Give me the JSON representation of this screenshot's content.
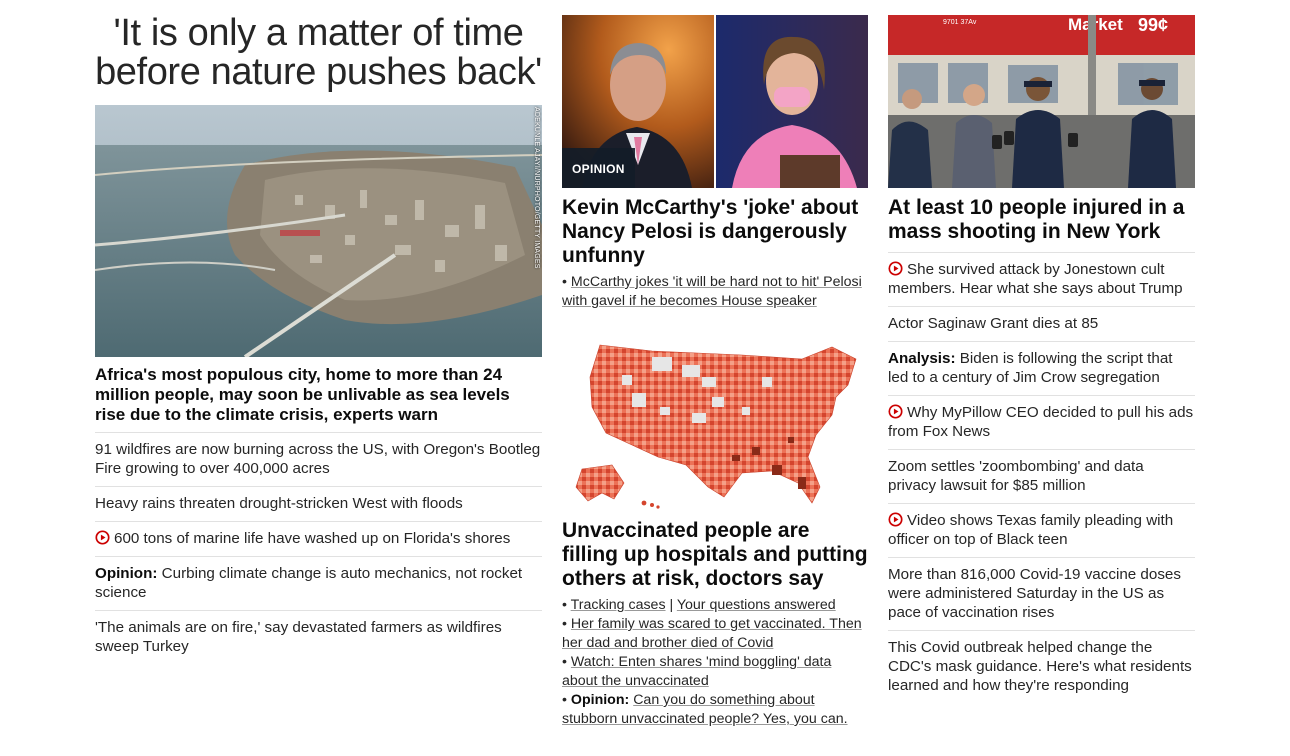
{
  "col1": {
    "headline": "'It is only a matter of time before nature pushes back'",
    "photo_credit": "ADEKUNLE AJAYI/NURPHOTO/GETTY IMAGES",
    "lead": "Africa's most populous city, home to more than 24 million people, may soon be unlivable as sea levels rise due to the climate crisis, experts warn",
    "items": [
      {
        "text": "91 wildfires are now burning across the US, with Oregon's Bootleg Fire growing to over 400,000 acres"
      },
      {
        "text": "Heavy rains threaten drought-stricken West with floods"
      },
      {
        "text": "600 tons of marine life have washed up on Florida's shores",
        "icon": "play-icon"
      },
      {
        "prefix": "Opinion:",
        "text": "Curbing climate change is auto mechanics, not rocket science"
      },
      {
        "text": "'The animals are on fire,' say devastated farmers as wildfires sweep Turkey"
      }
    ]
  },
  "col2": {
    "badge": "OPINION",
    "lead": "Kevin McCarthy's 'joke' about Nancy Pelosi is dangerously unfunny",
    "related": "McCarthy jokes 'it will be hard not to hit' Pelosi with gavel if he becomes House speaker",
    "lead2": "Unvaccinated people are filling up hospitals and putting others at risk, doctors say",
    "bullets": {
      "tracking": "Tracking cases",
      "separator": " | ",
      "questions": "Your questions answered",
      "family": "Her family was scared to get vaccinated. Then her dad and brother died of Covid",
      "watch": "Watch: Enten shares 'mind boggling' data about the unvaccinated",
      "opinion_prefix": "Opinion:",
      "opinion": "Can you do something about stubborn unvaccinated people? Yes, you can."
    }
  },
  "col3": {
    "photo_sign": "Market",
    "photo_address": "9701 37Av",
    "photo_price": "99¢",
    "lead": "At least 10 people injured in a mass shooting in New York",
    "items": [
      {
        "text": "She survived attack by Jonestown cult members. Hear what she says about Trump",
        "icon": "play-icon"
      },
      {
        "text": "Actor Saginaw Grant dies at 85"
      },
      {
        "prefix": "Analysis:",
        "text": "Biden is following the script that led to a century of Jim Crow segregation"
      },
      {
        "text": "Why MyPillow CEO decided to pull his ads from Fox News",
        "icon": "play-icon"
      },
      {
        "text": "Zoom settles 'zoombombing' and data privacy lawsuit for $85 million"
      },
      {
        "text": "Video shows Texas family pleading with officer on top of Black teen",
        "icon": "play-icon"
      },
      {
        "text": "More than 816,000 Covid-19 vaccine doses were administered Saturday in the US as pace of vaccination rises"
      },
      {
        "text": "This Covid outbreak helped change the CDC's mask guidance. Here's what residents learned and how they're responding"
      }
    ]
  },
  "colors": {
    "play": "#cc0000",
    "divider": "#e1e1e1",
    "text": "#262626"
  }
}
